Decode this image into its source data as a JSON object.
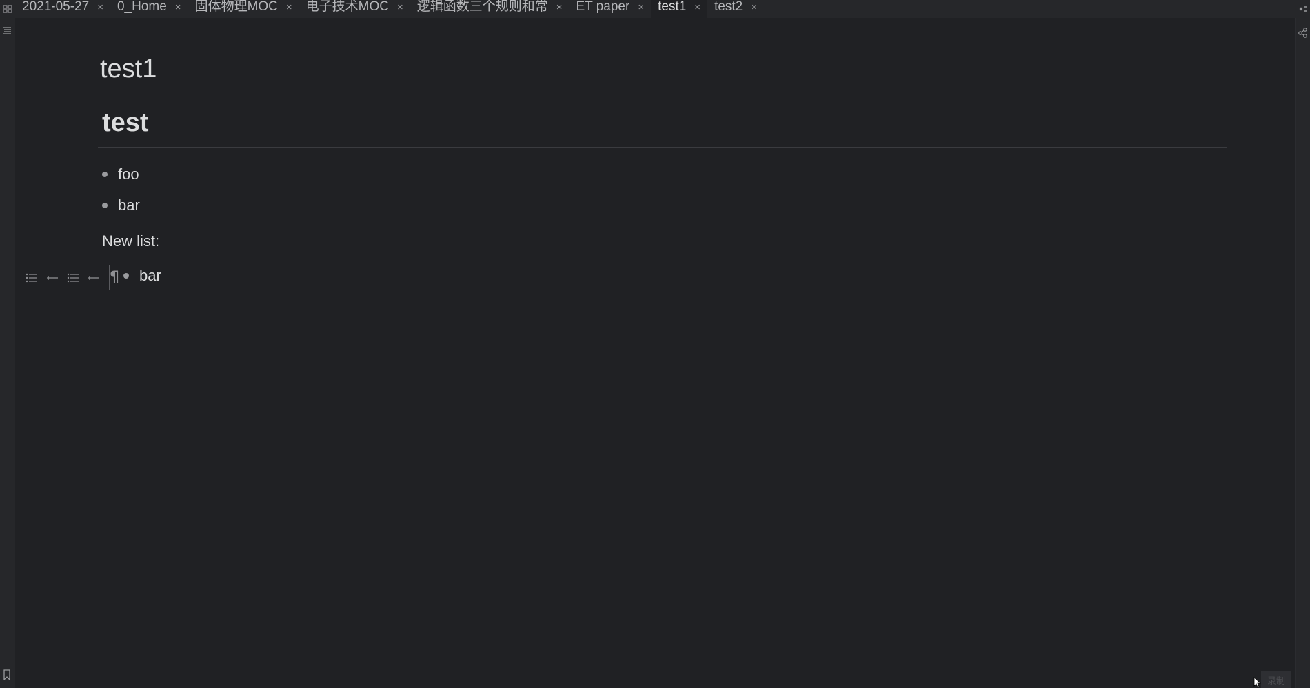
{
  "tabs": [
    {
      "label": "2021-05-27",
      "close": "×"
    },
    {
      "label": "0_Home",
      "close": "×"
    },
    {
      "label": "固体物理MOC",
      "close": "×"
    },
    {
      "label": "电子技术MOC",
      "close": "×"
    },
    {
      "label": "逻辑函数三个规则和常用",
      "close": "×"
    },
    {
      "label": "ET paper",
      "close": "×"
    },
    {
      "label": "test1",
      "close": "×"
    },
    {
      "label": "test2",
      "close": "×"
    }
  ],
  "active_tab_index": 6,
  "note": {
    "title": "test1",
    "heading": "test",
    "list_items": [
      "foo",
      "bar"
    ],
    "paragraph": "New list:",
    "new_list_items": [
      "bar"
    ]
  },
  "badge": {
    "label": "录制"
  },
  "icons": {
    "left_ribbon": [
      "outline-icon",
      "bookmark-icon"
    ],
    "toolbar": [
      "bullet-list-icon",
      "indent-icon",
      "bullet-list-icon",
      "indent-icon",
      "pilcrow-icon"
    ],
    "pilcrow_glyph": "¶"
  },
  "colors": {
    "background": "#202124",
    "tabbar": "#26272a",
    "text": "#dcddde",
    "muted": "#9a9b9e"
  }
}
